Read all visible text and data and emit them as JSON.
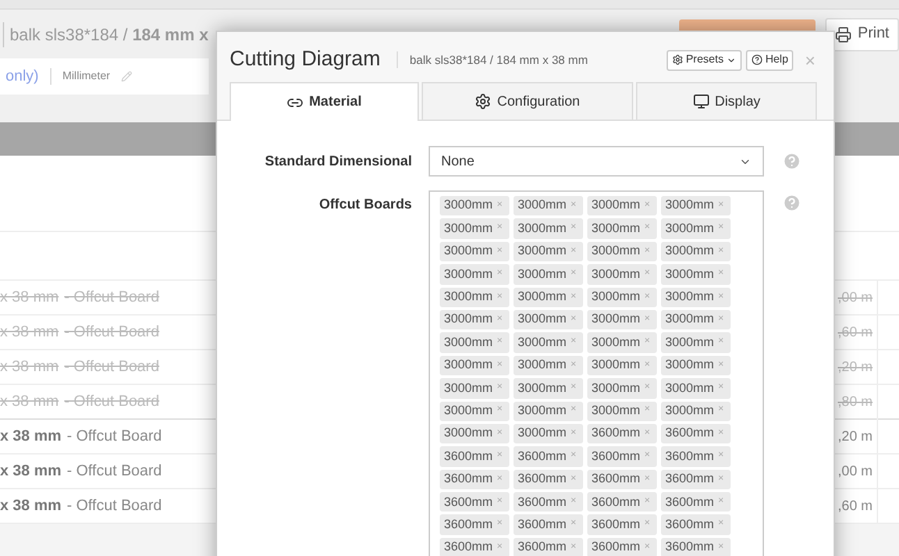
{
  "page": {
    "title": "balk sls38*184 / **184 mm x**",
    "print_button": "Print",
    "unit_link": "only)",
    "unit": "Millimeter",
    "rows": [
      {
        "text": "x 38 mm",
        "suffix": "- Offcut Board",
        "struck": true,
        "length": ",00 m"
      },
      {
        "text": "x 38 mm",
        "suffix": "- Offcut Board",
        "struck": true,
        "length": ",60 m"
      },
      {
        "text": "x 38 mm",
        "suffix": "- Offcut Board",
        "struck": true,
        "length": ",20 m"
      },
      {
        "text": "x 38 mm",
        "suffix": "- Offcut Board",
        "struck": true,
        "length": ",80 m"
      },
      {
        "text": "x 38 mm",
        "suffix": "- Offcut Board",
        "struck": false,
        "length": ",20 m"
      },
      {
        "text": "x 38 mm",
        "suffix": "- Offcut Board",
        "struck": false,
        "length": ",00 m"
      },
      {
        "text": "x 38 mm",
        "suffix": "- Offcut Board",
        "struck": false,
        "length": ",60 m"
      }
    ]
  },
  "dialog": {
    "title": "Cutting Diagram",
    "subtitle": "balk sls38*184 / 184 mm x 38 mm",
    "presets_button": "Presets",
    "help_button": "Help",
    "close": "×",
    "tabs": [
      {
        "label": "Material",
        "selected": true
      },
      {
        "label": "Configuration",
        "selected": false
      },
      {
        "label": "Display",
        "selected": false
      }
    ],
    "standard_dimensional": {
      "label": "Standard Dimensional",
      "value": "None"
    },
    "offcut_boards": {
      "label": "Offcut Boards",
      "tags": [
        "3000mm",
        "3000mm",
        "3000mm",
        "3000mm",
        "3000mm",
        "3000mm",
        "3000mm",
        "3000mm",
        "3000mm",
        "3000mm",
        "3000mm",
        "3000mm",
        "3000mm",
        "3000mm",
        "3000mm",
        "3000mm",
        "3000mm",
        "3000mm",
        "3000mm",
        "3000mm",
        "3000mm",
        "3000mm",
        "3000mm",
        "3000mm",
        "3000mm",
        "3000mm",
        "3000mm",
        "3000mm",
        "3000mm",
        "3000mm",
        "3000mm",
        "3000mm",
        "3000mm",
        "3000mm",
        "3000mm",
        "3000mm",
        "3000mm",
        "3000mm",
        "3000mm",
        "3000mm",
        "3000mm",
        "3000mm",
        "3600mm",
        "3600mm",
        "3600mm",
        "3600mm",
        "3600mm",
        "3600mm",
        "3600mm",
        "3600mm",
        "3600mm",
        "3600mm",
        "3600mm",
        "3600mm",
        "3600mm",
        "3600mm",
        "3600mm",
        "3600mm",
        "3600mm",
        "3600mm",
        "3600mm",
        "3600mm",
        "3600mm",
        "3600mm"
      ],
      "remove": "×"
    }
  }
}
